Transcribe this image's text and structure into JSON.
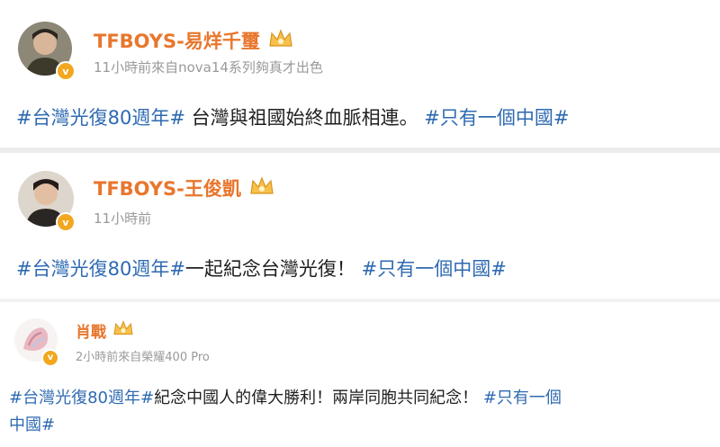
{
  "posts": [
    {
      "author": "TFBOYS-易烊千璽",
      "meta": "11小時前來自nova14系列夠真才出色",
      "tag1": "#台灣光復80週年#",
      "text": " 台灣與祖國始終血脈相連。 ",
      "tag2": "#只有一個中國#"
    },
    {
      "author": "TFBOYS-王俊凱",
      "meta": "11小時前",
      "tag1": "#台灣光復80週年#",
      "text": "一起紀念台灣光復！ ",
      "tag2": "#只有一個中國#"
    },
    {
      "author": "肖戰",
      "meta": "2小時前來自榮耀400 Pro",
      "tag1": "#台灣光復80週年#",
      "text": "紀念中國人的偉大勝利！兩岸同胞共同紀念！ ",
      "tag2a": "#只有一個",
      "tag2b": "中國#"
    }
  ],
  "verified_badge": "v",
  "icons": {
    "avatar": "user-avatar",
    "badge": "verified-badge-icon",
    "crown": "crown-icon"
  },
  "colors": {
    "author_name": "#e8762d",
    "hashtag": "#2e6ab1",
    "meta": "#9a9a9a",
    "badge": "#f2a71f",
    "divider": "#ececec"
  }
}
